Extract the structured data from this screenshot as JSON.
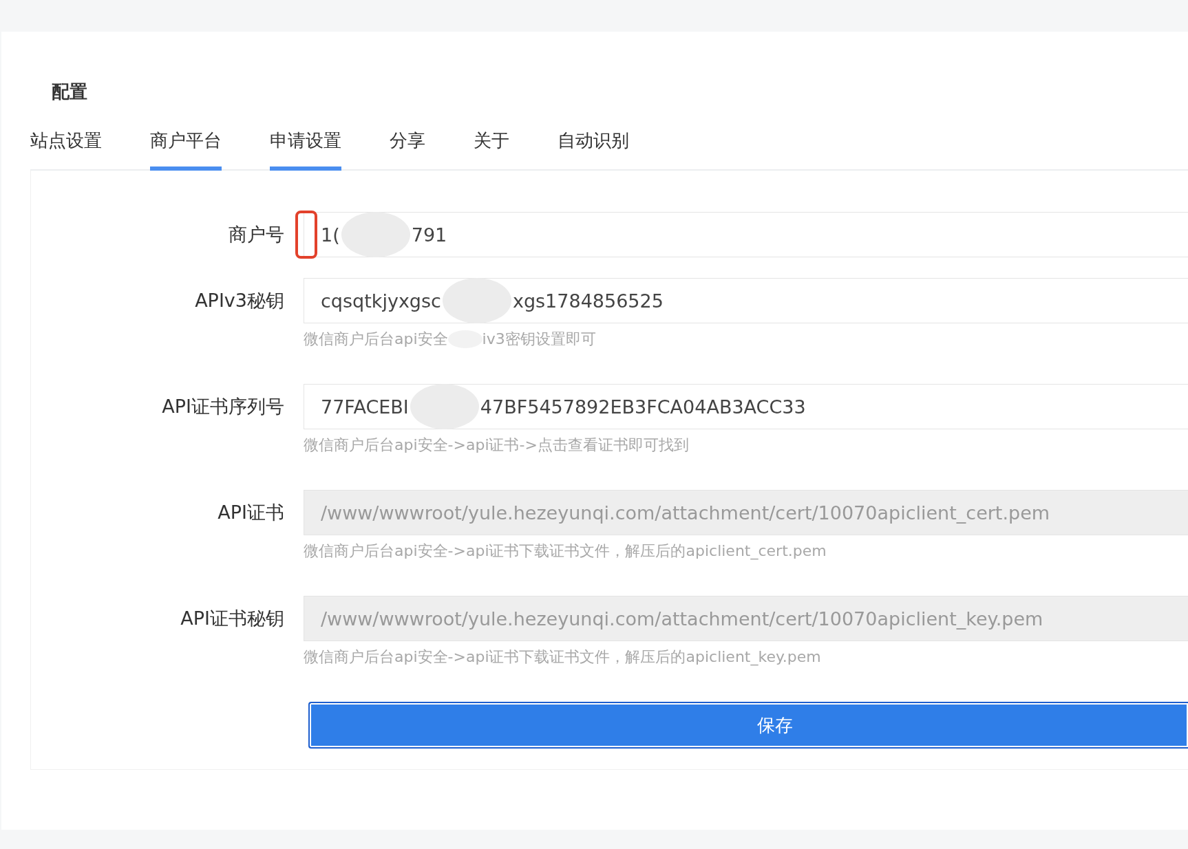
{
  "title": "配置",
  "tabs": [
    {
      "label": "站点设置",
      "selected": false
    },
    {
      "label": "商户平台",
      "selected": true
    },
    {
      "label": "申请设置",
      "selected": true
    },
    {
      "label": "分享",
      "selected": false
    },
    {
      "label": "关于",
      "selected": false
    },
    {
      "label": "自动识别",
      "selected": false
    }
  ],
  "fields": [
    {
      "label": "商户号",
      "value_parts": [
        "1(",
        "791"
      ],
      "disabled": false,
      "highlighted": true
    },
    {
      "label": "APIv3秘钥",
      "value_parts": [
        "cqsqtkjyxgsc",
        "xgs1784856525"
      ],
      "hint_parts": [
        "微信商户后台api安全",
        "iv3密钥设置即可"
      ],
      "disabled": false,
      "highlighted": false
    },
    {
      "label": "API证书序列号",
      "value_parts": [
        "77FACEBI",
        "47BF5457892EB3FCA04AB3ACC33"
      ],
      "hint_parts": [
        "微信商户后台api安全->api证书->点击查看证书即可找到"
      ],
      "disabled": false,
      "highlighted": false
    },
    {
      "label": "API证书",
      "value_parts": [
        "/www/wwwroot/yule.hezeyunqi.com/attachment/cert/10070apiclient_cert.pem"
      ],
      "hint_parts": [
        "微信商户后台api安全->api证书下载证书文件，解压后的apiclient_cert.pem"
      ],
      "disabled": true,
      "highlighted": false
    },
    {
      "label": "API证书秘钥",
      "value_parts": [
        "/www/wwwroot/yule.hezeyunqi.com/attachment/cert/10070apiclient_key.pem"
      ],
      "hint_parts": [
        "微信商户后台api安全->api证书下载证书文件，解压后的apiclient_key.pem"
      ],
      "disabled": true,
      "highlighted": false
    }
  ],
  "save_button": "保存"
}
